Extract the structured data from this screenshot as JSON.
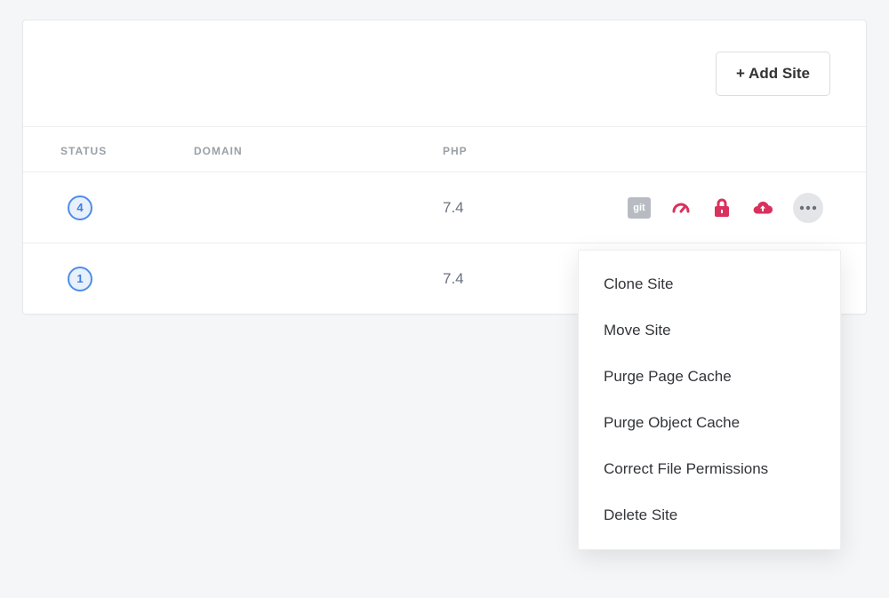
{
  "colors": {
    "accent": "#d9325e",
    "badge_ring": "#4d8ee8"
  },
  "header": {
    "add_site_label": "+ Add Site"
  },
  "columns": {
    "status": "STATUS",
    "domain": "DOMAIN",
    "php": "PHP"
  },
  "rows": [
    {
      "status": "4",
      "domain": "",
      "php": "7.4",
      "git_label": "git"
    },
    {
      "status": "1",
      "domain": "",
      "php": "7.4"
    }
  ],
  "menu": {
    "items": [
      "Clone Site",
      "Move Site",
      "Purge Page Cache",
      "Purge Object Cache",
      "Correct File Permissions",
      "Delete Site"
    ]
  }
}
